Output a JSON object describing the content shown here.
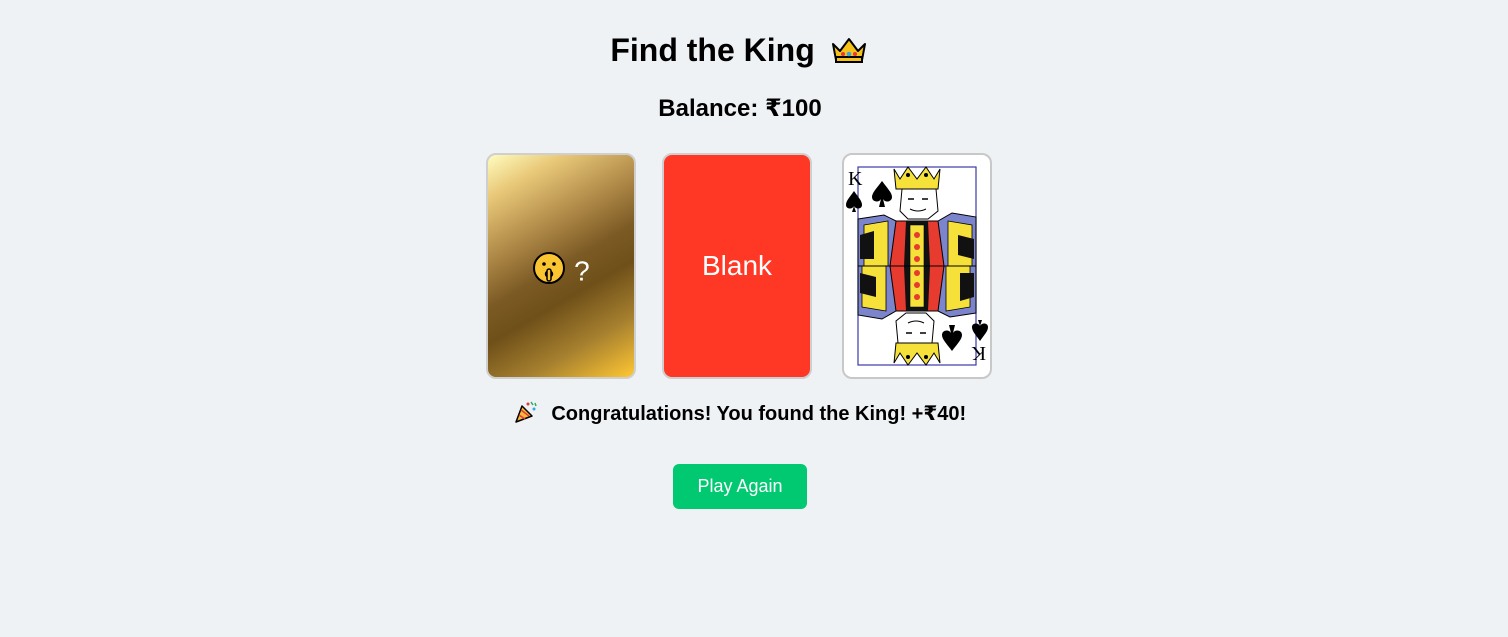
{
  "header": {
    "title": "Find the King",
    "title_icon": "crown-icon",
    "balance": "Balance: ₹100"
  },
  "cards": [
    {
      "state": "face-down",
      "face_icon": "shushing-face-icon",
      "label": "?",
      "color": "#b58f4c"
    },
    {
      "state": "revealed",
      "label": "Blank",
      "color": "#ff3826"
    },
    {
      "state": "revealed",
      "label": "King of Spades",
      "rank": "K",
      "suit": "spade",
      "color": "#ffffff"
    }
  ],
  "result": {
    "icon": "party-popper-icon",
    "message": "Congratulations! You found the King! +₹40!"
  },
  "actions": {
    "play_again_label": "Play Again",
    "accent": "#00c971"
  }
}
